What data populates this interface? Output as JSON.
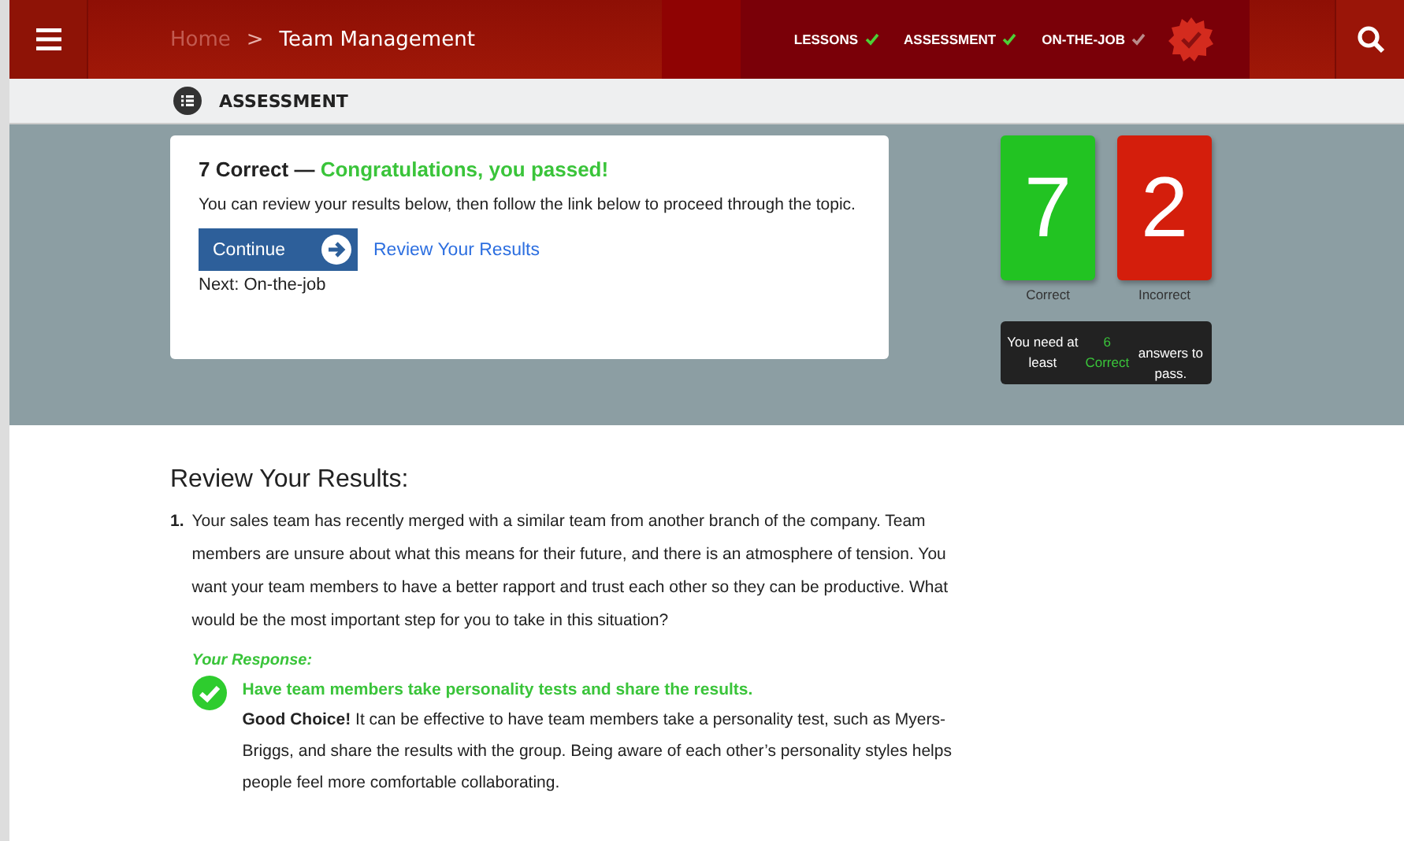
{
  "header": {
    "breadcrumb": [
      {
        "label": "Home",
        "selected": false
      },
      {
        "label": "Team Management",
        "selected": true
      }
    ],
    "separator": ">",
    "steps": [
      {
        "label": "LESSONS",
        "done": true
      },
      {
        "label": "ASSESSMENT",
        "done": true
      },
      {
        "label": "ON-THE-JOB",
        "done": false
      }
    ]
  },
  "subheader": {
    "title": "ASSESSMENT"
  },
  "result": {
    "heading": "7 Correct —",
    "status": "Congratulations, you passed!",
    "message": "You can review your results below, then follow the link below to proceed through the topic.",
    "continue_button": "Continue",
    "review_link": "Review Your Results",
    "next": "Next: On-the-job"
  },
  "scores": [
    {
      "value": "7",
      "label": "Correct",
      "kind": "correct"
    },
    {
      "value": "2",
      "label": "Incorrect",
      "kind": "incorrect"
    }
  ],
  "requirement": {
    "before": "You need at least",
    "highlight": "6 Correct",
    "after": "answers to pass."
  },
  "review": {
    "title": "Review Your Results:",
    "questions": [
      {
        "number": "1.",
        "text": "Your sales team has recently merged with a similar team from another branch of the company. Team members are unsure about what this means for their future, and there is an atmosphere of tension. You want your team members to have a better rapport and trust each other so they can be productive. What would be the most important step for you to take in this situation?",
        "response_label": "Your Response:",
        "response": "Have team members take personality tests and share the results.",
        "correct": true,
        "feedback": "**Good Choice!** It can be effective to have team members take a personality test, such as Myers-Briggs, and share the results with the group. Being aware of each other’s personality styles helps people feel more comfortable collaborating."
      }
    ]
  }
}
